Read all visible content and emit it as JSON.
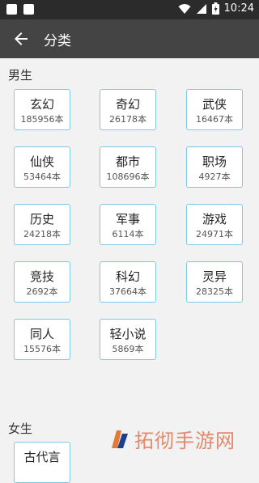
{
  "status_bar": {
    "time": "10:24"
  },
  "toolbar": {
    "title": "分类"
  },
  "sections": {
    "male": {
      "label": "男生",
      "items": [
        {
          "name": "玄幻",
          "count": "185956本"
        },
        {
          "name": "奇幻",
          "count": "26178本"
        },
        {
          "name": "武侠",
          "count": "16467本"
        },
        {
          "name": "仙侠",
          "count": "53464本"
        },
        {
          "name": "都市",
          "count": "108696本"
        },
        {
          "name": "职场",
          "count": "4927本"
        },
        {
          "name": "历史",
          "count": "24218本"
        },
        {
          "name": "军事",
          "count": "6114本"
        },
        {
          "name": "游戏",
          "count": "24971本"
        },
        {
          "name": "竞技",
          "count": "2692本"
        },
        {
          "name": "科幻",
          "count": "37664本"
        },
        {
          "name": "灵异",
          "count": "28325本"
        },
        {
          "name": "同人",
          "count": "15576本"
        },
        {
          "name": "轻小说",
          "count": "5869本"
        }
      ]
    },
    "female": {
      "label": "女生",
      "items": [
        {
          "name": "古代言"
        }
      ]
    }
  },
  "watermark": {
    "text": "拓彻手游网"
  },
  "icons": [
    "back-arrow-icon",
    "wifi-icon",
    "signal-icon",
    "battery-icon",
    "notification-icon"
  ],
  "colors": {
    "toolbar": "#444444",
    "statusbar": "#2b2b2b",
    "card_border": "#7ec8e3",
    "background": "#f2f2f2"
  }
}
